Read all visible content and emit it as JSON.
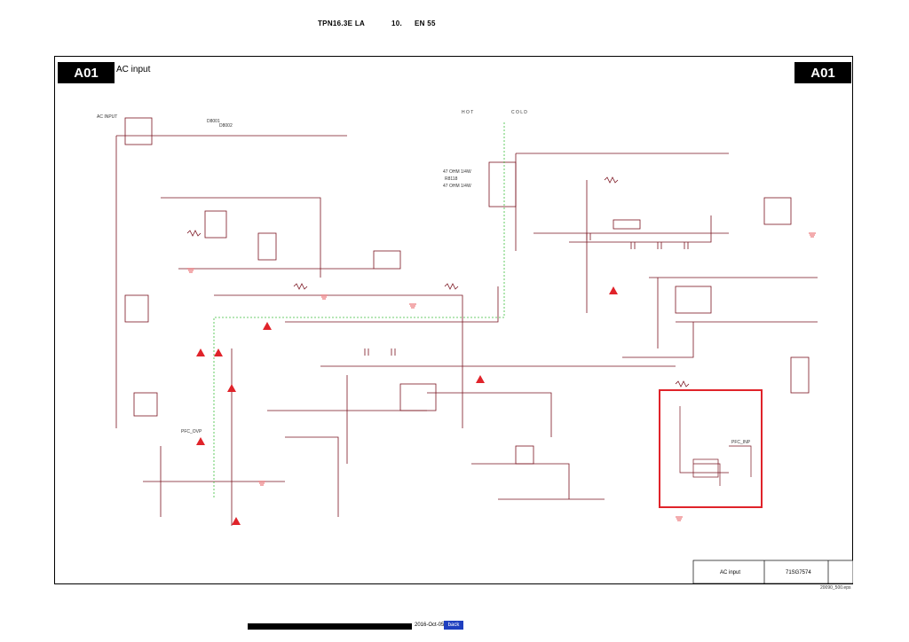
{
  "header": {
    "model": "TPN16.3E LA",
    "chapter": "10.",
    "page": "EN 55"
  },
  "sheet": {
    "badge_left": "A01",
    "badge_right": "A01",
    "title": "AC input"
  },
  "schematic_labels": {
    "hot": "H O T",
    "cold": "C O L D",
    "d8001": "D8001",
    "d8002": "D8002",
    "ac_input": "AC INPUT",
    "r8118": "R8118",
    "pfc_ovp": "PFC_OVP",
    "pfc_inp": "PFC_INP",
    "value1": "47 OHM 1/4W",
    "value2": "47 OHM 1/4W"
  },
  "title_block": {
    "name": "AC input",
    "code": "71SG7574"
  },
  "file_name": "20090_500.eps",
  "footer": {
    "date": "2016-Oct-05",
    "link": "back"
  },
  "colors": {
    "wire": "#7a1420",
    "highlight": "#e0232a",
    "isolation": "#3cbf3c"
  }
}
